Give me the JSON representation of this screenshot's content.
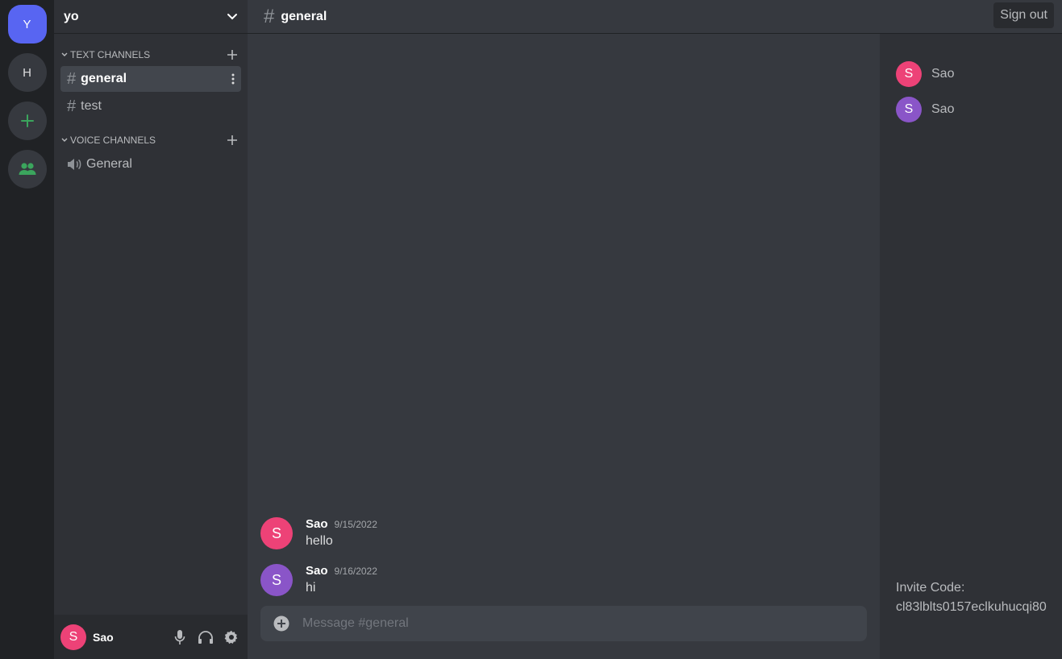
{
  "servers": [
    {
      "label": "Y",
      "active": true
    },
    {
      "label": "H",
      "active": false
    }
  ],
  "icons": {
    "add_server": "plus-icon",
    "friends": "people-icon",
    "chevron": "chevron-down-icon",
    "mic": "microphone-icon",
    "headphones": "headphones-icon",
    "settings": "gear-icon",
    "composer_add": "plus-circle-icon"
  },
  "colors": {
    "accent": "#5865f2",
    "green": "#3ba55d",
    "avatar_pink": "#ed4277",
    "avatar_purple": "#8a55c8"
  },
  "server_header": {
    "name": "yo"
  },
  "categories": {
    "text": {
      "label": "TEXT CHANNELS"
    },
    "voice": {
      "label": "VOICE CHANNELS"
    }
  },
  "text_channels": [
    {
      "name": "general",
      "active": true
    },
    {
      "name": "test",
      "active": false
    }
  ],
  "voice_channels": [
    {
      "name": "General"
    }
  ],
  "user_panel": {
    "avatar_letter": "S",
    "name": "Sao"
  },
  "channel_header": {
    "hash": "#",
    "title": "general"
  },
  "messages": [
    {
      "avatar_letter": "S",
      "author": "Sao",
      "time": "9/15/2022",
      "text": "hello"
    },
    {
      "avatar_letter": "S",
      "author": "Sao",
      "time": "9/16/2022",
      "text": "hi"
    }
  ],
  "composer": {
    "placeholder": "Message #general"
  },
  "members": [
    {
      "avatar_letter": "S",
      "name": "Sao"
    },
    {
      "avatar_letter": "S",
      "name": "Sao"
    }
  ],
  "invite": {
    "label": "Invite Code:",
    "code": "cl83lblts0157eclkuhucqi80"
  },
  "signout": {
    "label": "Sign out"
  }
}
